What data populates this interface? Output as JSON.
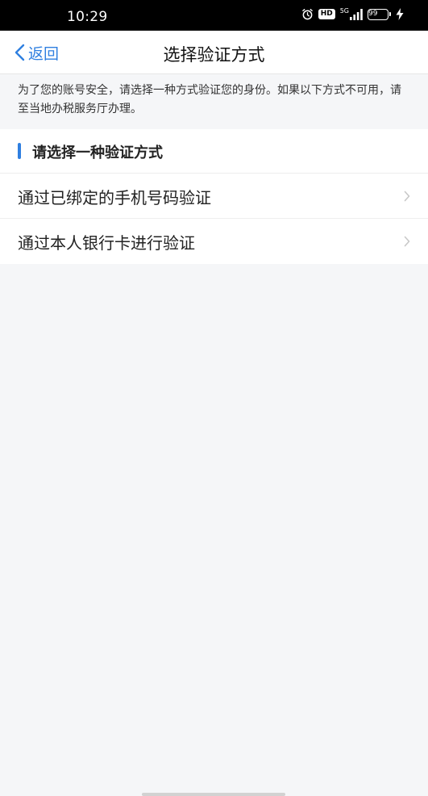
{
  "status_bar": {
    "time": "10:29",
    "network": "5G",
    "hd_label": "HD",
    "battery": "99",
    "icons": [
      "alarm-icon",
      "hd-icon",
      "signal-5g-icon",
      "battery-icon",
      "charging-icon"
    ]
  },
  "nav": {
    "back_label": "返回",
    "title": "选择验证方式"
  },
  "notice": {
    "text": "为了您的账号安全，请选择一种方式验证您的身份。如果以下方式不可用，请至当地办税服务厅办理。"
  },
  "section": {
    "title": "请选择一种验证方式"
  },
  "options": [
    {
      "label": "通过已绑定的手机号码验证"
    },
    {
      "label": "通过本人银行卡进行验证"
    }
  ],
  "colors": {
    "accent": "#2f7fe0",
    "background": "#f5f6f8",
    "card": "#ffffff"
  }
}
